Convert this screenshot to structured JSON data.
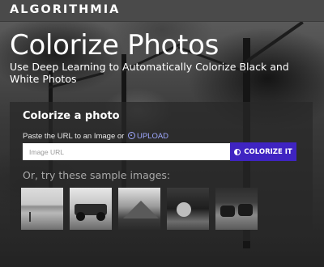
{
  "header": {
    "brand": "ALGORITHMIA"
  },
  "hero": {
    "title": "Colorize Photos",
    "subtitle": "Use Deep Learning to Automatically Colorize Black and White Photos"
  },
  "form": {
    "heading": "Colorize a photo",
    "paste_text": "Paste the URL to an Image or",
    "upload_label": "UPLOAD",
    "url_placeholder": "Image URL",
    "url_value": "",
    "submit_label": "COLORIZE IT",
    "samples_label": "Or, try these sample images:"
  },
  "samples": [
    {
      "name": "beach-photo"
    },
    {
      "name": "race-car-photo"
    },
    {
      "name": "mountain-photo"
    },
    {
      "name": "flower-photo"
    },
    {
      "name": "cattle-photo"
    }
  ],
  "colors": {
    "topbar": "#4a4a4a",
    "accent_button": "#3f24c2",
    "upload_link": "#9fa8ff"
  },
  "icons": {
    "upload": "circle-up-arrow-icon",
    "colorize": "half-circle-icon"
  }
}
